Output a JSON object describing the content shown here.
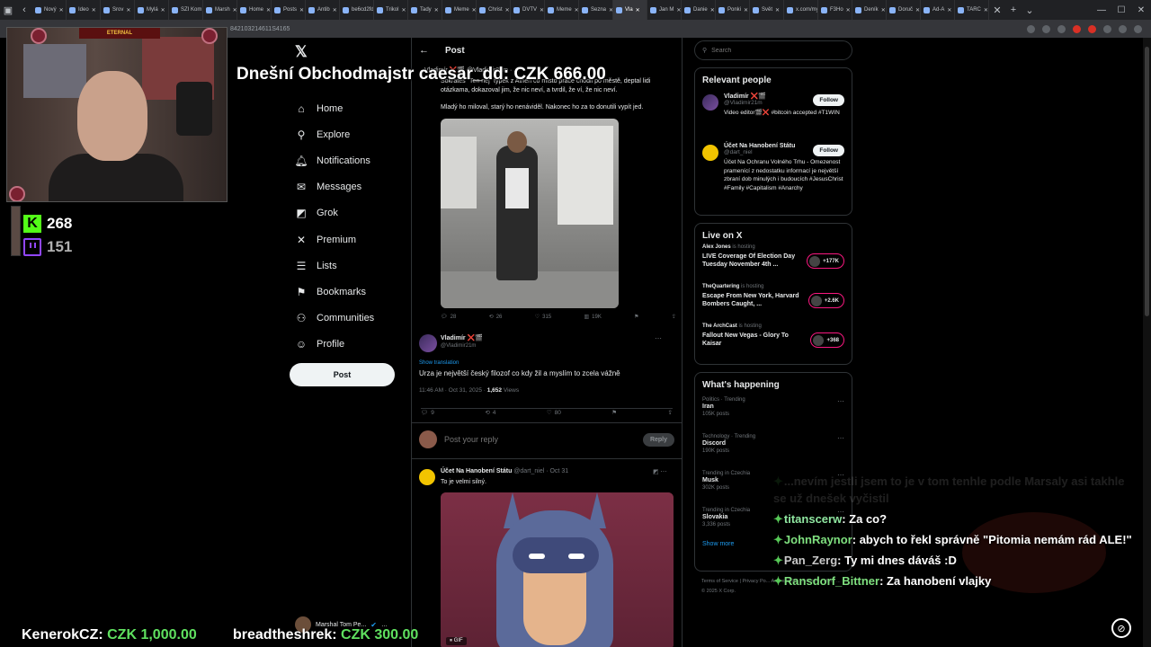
{
  "browser": {
    "tabs": [
      {
        "label": "Nový"
      },
      {
        "label": "Ideo"
      },
      {
        "label": "Srov"
      },
      {
        "label": "Mylá"
      },
      {
        "label": "SZI Kom"
      },
      {
        "label": "Marsh"
      },
      {
        "label": "Home"
      },
      {
        "label": "Posts"
      },
      {
        "label": "Antib"
      },
      {
        "label": "be6cd2fd"
      },
      {
        "label": "Trikol"
      },
      {
        "label": "Tady"
      },
      {
        "label": "Meme"
      },
      {
        "label": "Christ"
      },
      {
        "label": "DVTV"
      },
      {
        "label": "Meme"
      },
      {
        "label": "Sezna"
      },
      {
        "label": "Vla"
      },
      {
        "label": "Jan M"
      },
      {
        "label": "Danie"
      },
      {
        "label": "Ponki"
      },
      {
        "label": "Svět"
      },
      {
        "label": "x.com/my"
      },
      {
        "label": "F3Ho"
      },
      {
        "label": "Deník"
      },
      {
        "label": "Doruč"
      },
      {
        "label": "Ad-A"
      },
      {
        "label": "TARC"
      }
    ],
    "active_tab_index": 17,
    "url_fragment": "842103214611S4165"
  },
  "x": {
    "nav": [
      {
        "label": "Home",
        "icon": "home-icon",
        "glyph": "⌂"
      },
      {
        "label": "Explore",
        "icon": "search-icon",
        "glyph": "⚲"
      },
      {
        "label": "Notifications",
        "icon": "bell-icon",
        "glyph": "🔔︎"
      },
      {
        "label": "Messages",
        "icon": "mail-icon",
        "glyph": "✉"
      },
      {
        "label": "Grok",
        "icon": "grok-icon",
        "glyph": "◩"
      },
      {
        "label": "Premium",
        "icon": "x-logo-icon",
        "glyph": "✕"
      },
      {
        "label": "Lists",
        "icon": "list-icon",
        "glyph": "☰"
      },
      {
        "label": "Bookmarks",
        "icon": "bookmark-icon",
        "glyph": "⚑"
      },
      {
        "label": "Communities",
        "icon": "communities-icon",
        "glyph": "⚇"
      },
      {
        "label": "Profile",
        "icon": "profile-icon",
        "glyph": "☺"
      },
      {
        "label": "More",
        "icon": "more-icon",
        "glyph": "⋯"
      }
    ],
    "post_button": "Post",
    "account": {
      "name": "Marshal Tom Pe...",
      "more": "…"
    },
    "column_title": "Post",
    "quoted": {
      "head": "Vladimír ❌🎬 @Vladimir21m · ...",
      "text1": "Sokrates \"Ten nej\" typek z Athén co místo práce chodil po městě, deptal lidi otázkama, dokazoval jim, že nic neví, a tvrdil, že ví, že nic neví.",
      "text2": "Mladý ho miloval, starý ho nenáviděl. Nakonec ho za to donutili vypít jed.",
      "stats": {
        "replies": "28",
        "reposts": "26",
        "likes": "315",
        "views": "19K"
      }
    },
    "reply": {
      "name": "Vladimír ❌🎬",
      "handle": "@Vladimir21m",
      "show_translation": "Show translation",
      "text": "Urza je největší český filozof co kdy žil a myslím to zcela vážně",
      "time": "11:46 AM · Oct 31, 2025 · ",
      "views_count": "1,652",
      "views_label": " Views",
      "stats": {
        "replies": "9",
        "reposts": "4",
        "likes": "80"
      }
    },
    "reply_box": {
      "placeholder": "Post your reply",
      "button": "Reply"
    },
    "reply2": {
      "name": "Účet Na Hanobení Státu",
      "meta": " @dart_niel · Oct 31",
      "text": "To je velmi silný.",
      "gif_tag": "GIF"
    },
    "search_placeholder": "Search",
    "relevant": {
      "title": "Relevant people",
      "people": [
        {
          "name": "Vladimír ❌🎬",
          "handle": "@Vladimir21m",
          "bio": "Video editor🎬❌ #bitcoin accepted #T1WIN",
          "follow": "Follow"
        },
        {
          "name": "Účet Na Hanobení Státu",
          "handle": "@dart_niel",
          "bio": "Účet Na Ochranu Volného Trhu - Omezenost pramenící z nedostatku informací je největší zbraní dob minulých i budoucích #JesusChrist #Family #Capitalism #Anarchy",
          "follow": "Follow"
        }
      ]
    },
    "live": {
      "title": "Live on X",
      "items": [
        {
          "host": "Alex Jones",
          "state": " is hosting",
          "title": "LIVE Coverage Of Election Day Tuesday November 4th ...",
          "count": "+177K"
        },
        {
          "host": "TheQuartering",
          "state": " is hosting",
          "title": "Escape From New York, Harvard Bombers Caught, ...",
          "count": "+2.6K"
        },
        {
          "host": "The ArchCast",
          "state": " is hosting",
          "title": "Fallout New Vegas - Glory To Kaisar",
          "count": "+368"
        }
      ]
    },
    "happening": {
      "title": "What's happening",
      "trends": [
        {
          "context": "Politics · Trending",
          "name": "Iran",
          "count": "105K posts"
        },
        {
          "context": "Technology · Trending",
          "name": "Discord",
          "count": "190K posts"
        },
        {
          "context": "Trending in Czechia",
          "name": "Musk",
          "count": "302K posts"
        },
        {
          "context": "Trending in Czechia",
          "name": "Slovakia",
          "count": "3,336 posts"
        }
      ],
      "show_more": "Show more"
    },
    "footer": "Terms of Service | Privacy Po... Accessibility | Ads info | More ... © 2025 X Corp."
  },
  "stream": {
    "headline": "Dnešní Obchodmajstr caesar_dd: CZK 666.00",
    "viewers": {
      "kick": "268",
      "twitch": "151"
    },
    "webcam_banner": "ETERNAL",
    "donations": [
      {
        "user": "KenerokCZ: ",
        "amount": "CZK 1,000.00"
      },
      {
        "user": "breadtheshrek: ",
        "amount": "CZK 300.00"
      }
    ],
    "chat": [
      {
        "user": "",
        "text": "...nevím jestli jsem to je v tom tenhle podle Marsaly asi takhle se už dnešek vyčistil"
      },
      {
        "user": "titanscerw",
        "text": " Za co?"
      },
      {
        "user": "JohnRaynor",
        "text": " abych to řekl správně \"Pitomia nemám rád ALE!\""
      },
      {
        "user": "Pan_Zerg",
        "text": " Ty mi dnes dáváš :D"
      },
      {
        "user": "Ransdorf_Bittner",
        "text": " Za hanobení vlajky"
      }
    ]
  }
}
